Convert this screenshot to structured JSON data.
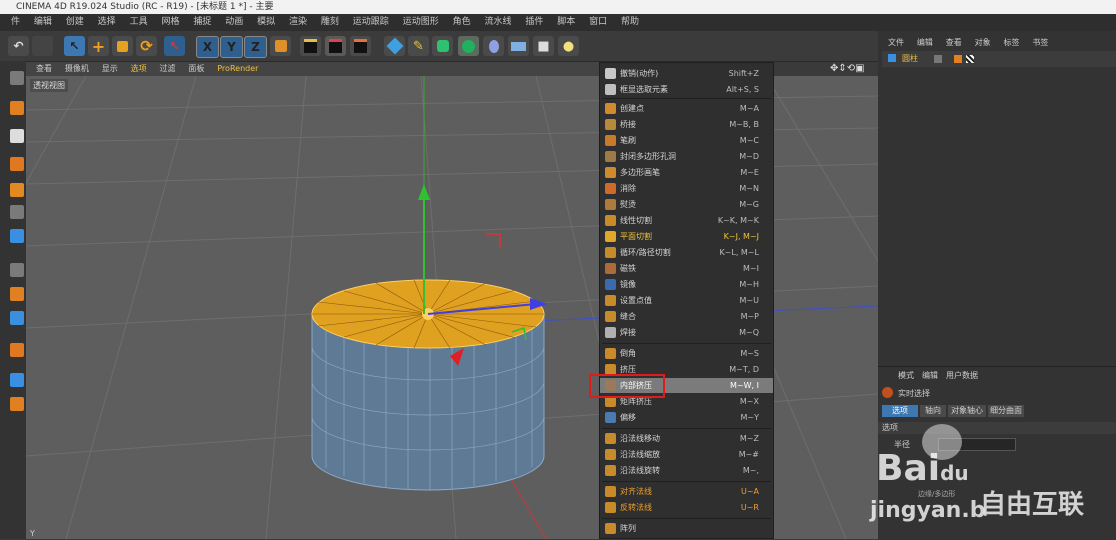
{
  "window": {
    "title": "CINEMA 4D R19.024 Studio (RC - R19) - [未标题 1 *] - 主要"
  },
  "menubar": [
    "件",
    "编辑",
    "创建",
    "选择",
    "工具",
    "网格",
    "捕捉",
    "动画",
    "模拟",
    "渲染",
    "雕刻",
    "运动跟踪",
    "运动图形",
    "角色",
    "流水线",
    "插件",
    "脚本",
    "窗口",
    "帮助"
  ],
  "toolbar": {
    "axis_x": "X",
    "axis_y": "Y",
    "axis_z": "Z"
  },
  "viewport": {
    "menu": [
      "查看",
      "摄像机",
      "显示",
      "选项",
      "过滤",
      "面板",
      "ProRender"
    ],
    "label": "透视视图",
    "axis_label": "Y"
  },
  "context_menu": {
    "items": [
      {
        "label": "撤销(动作)",
        "shortcut": "Shift+Z",
        "icon": "undo-icon",
        "color": "#c9c9c9"
      },
      {
        "label": "框显选取元素",
        "shortcut": "Alt+S, S",
        "icon": "frame-selection-icon",
        "color": "#bfbfbf"
      },
      {
        "label": "创建点",
        "shortcut": "M~A",
        "icon": "create-point-icon",
        "color": "#d18b2c"
      },
      {
        "label": "桥接",
        "shortcut": "M~B, B",
        "icon": "bridge-icon",
        "color": "#b8893a"
      },
      {
        "label": "笔刷",
        "shortcut": "M~C",
        "icon": "brush-icon",
        "color": "#c77a2a"
      },
      {
        "label": "封闭多边形孔洞",
        "shortcut": "M~D",
        "icon": "close-hole-icon",
        "color": "#a07a44"
      },
      {
        "label": "多边形画笔",
        "shortcut": "M~E",
        "icon": "polygon-pen-icon",
        "color": "#d08a2c"
      },
      {
        "label": "消除",
        "shortcut": "M~N",
        "icon": "dissolve-icon",
        "color": "#d06a2a"
      },
      {
        "label": "熨烫",
        "shortcut": "M~G",
        "icon": "iron-icon",
        "color": "#b07a3a"
      },
      {
        "label": "线性切割",
        "shortcut": "K~K, M~K",
        "icon": "line-cut-icon",
        "color": "#c98a2a"
      },
      {
        "label": "平面切割",
        "shortcut": "K~J, M~J",
        "icon": "plane-cut-icon",
        "color": "#e0a72a",
        "style": "yellow"
      },
      {
        "label": "循环/路径切割",
        "shortcut": "K~L, M~L",
        "icon": "loop-cut-icon",
        "color": "#c98a2a"
      },
      {
        "label": "磁铁",
        "shortcut": "M~I",
        "icon": "magnet-icon",
        "color": "#b06a3a"
      },
      {
        "label": "镜像",
        "shortcut": "M~H",
        "icon": "mirror-icon",
        "color": "#3a6ab0"
      },
      {
        "label": "设置点值",
        "shortcut": "M~U",
        "icon": "set-point-value-icon",
        "color": "#c98a2a"
      },
      {
        "label": "缝合",
        "shortcut": "M~P",
        "icon": "stitch-icon",
        "color": "#c98a2a"
      },
      {
        "label": "焊接",
        "shortcut": "M~Q",
        "icon": "weld-icon",
        "color": "#b0b0b0"
      },
      {
        "label": "倒角",
        "shortcut": "M~S",
        "icon": "bevel-icon",
        "color": "#c98a2a"
      },
      {
        "label": "挤压",
        "shortcut": "M~T, D",
        "icon": "extrude-icon",
        "color": "#c98a2a"
      },
      {
        "label": "内部挤压",
        "shortcut": "M~W, I",
        "icon": "extrude-inner-icon",
        "color": "#9a7a5a",
        "style": "highlight"
      },
      {
        "label": "矩阵挤压",
        "shortcut": "M~X",
        "icon": "matrix-extrude-icon",
        "color": "#c98a2a"
      },
      {
        "label": "偏移",
        "shortcut": "M~Y",
        "icon": "offset-icon",
        "color": "#4a7ab0"
      },
      {
        "label": "沿法线移动",
        "shortcut": "M~Z",
        "icon": "normal-move-icon",
        "color": "#c98a2a"
      },
      {
        "label": "沿法线缩放",
        "shortcut": "M~#",
        "icon": "normal-scale-icon",
        "color": "#c98a2a"
      },
      {
        "label": "沿法线旋转",
        "shortcut": "M~,",
        "icon": "normal-rotate-icon",
        "color": "#c98a2a"
      },
      {
        "label": "对齐法线",
        "shortcut": "U~A",
        "icon": "align-normals-icon",
        "color": "#c98a2a",
        "style": "orange"
      },
      {
        "label": "反转法线",
        "shortcut": "U~R",
        "icon": "reverse-normals-icon",
        "color": "#c98a2a",
        "style": "orange"
      },
      {
        "label": "阵列",
        "shortcut": "",
        "icon": "array-icon",
        "color": "#c98a2a"
      }
    ]
  },
  "object_manager": {
    "tabs": [
      "文件",
      "编辑",
      "查看",
      "对象",
      "标签",
      "书签"
    ],
    "object_name": "圆柱"
  },
  "attribute_manager": {
    "tabs": [
      "模式",
      "编辑",
      "用户数据"
    ],
    "mode_title": "实时选择",
    "sub_tabs": [
      "选项",
      "轴向",
      "对象轴心",
      "细分曲面"
    ],
    "section": "选项",
    "param_label": "半径",
    "param_value": "",
    "footnote": "边缘/多边形"
  },
  "watermark": {
    "baidu": "Bai",
    "baidu_du": "du",
    "jingyan": "jingyan.b",
    "ziyou": "自由互联"
  }
}
